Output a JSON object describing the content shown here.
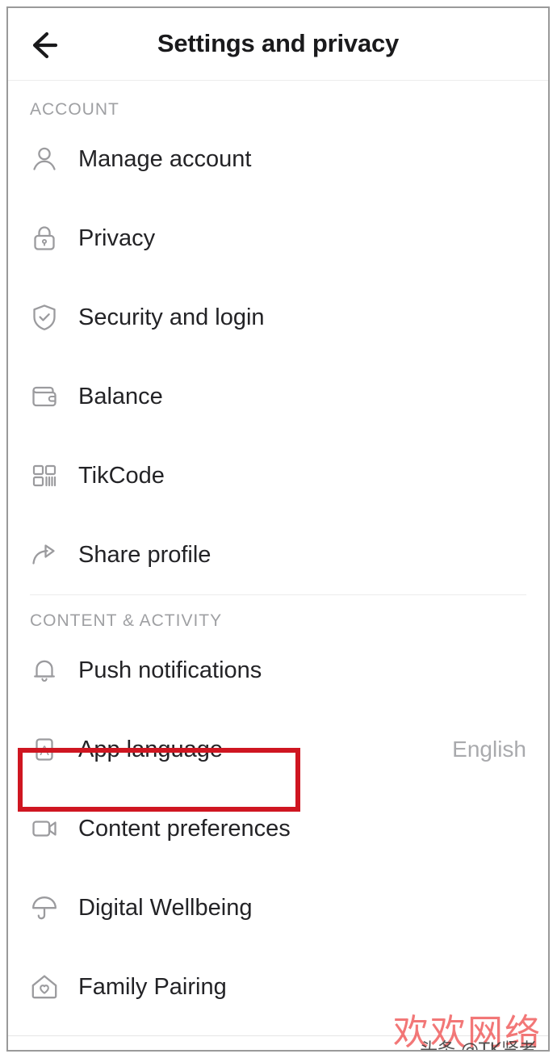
{
  "header": {
    "title": "Settings and privacy",
    "back_icon": "arrow-left-icon"
  },
  "sections": [
    {
      "id": "account",
      "title": "ACCOUNT",
      "rows": [
        {
          "icon": "person-icon",
          "label": "Manage account",
          "value": ""
        },
        {
          "icon": "lock-icon",
          "label": "Privacy",
          "value": ""
        },
        {
          "icon": "shield-check-icon",
          "label": "Security and login",
          "value": ""
        },
        {
          "icon": "wallet-icon",
          "label": "Balance",
          "value": ""
        },
        {
          "icon": "qrcode-icon",
          "label": "TikCode",
          "value": ""
        },
        {
          "icon": "share-arrow-icon",
          "label": "Share profile",
          "value": ""
        }
      ]
    },
    {
      "id": "content",
      "title": "CONTENT & ACTIVITY",
      "rows": [
        {
          "icon": "bell-icon",
          "label": "Push notifications",
          "value": ""
        },
        {
          "icon": "letter-a-box-icon",
          "label": "App language",
          "value": "English"
        },
        {
          "icon": "video-camera-icon",
          "label": "Content preferences",
          "value": ""
        },
        {
          "icon": "umbrella-icon",
          "label": "Digital Wellbeing",
          "value": ""
        },
        {
          "icon": "house-heart-icon",
          "label": "Family Pairing",
          "value": ""
        }
      ]
    }
  ],
  "annotation": {
    "highlight_target": "App language",
    "highlight_color": "#cf1621"
  },
  "watermarks": {
    "main": "欢欢网络",
    "sub": "头条 @TK贤者",
    "main_color": "#f05a5a"
  }
}
